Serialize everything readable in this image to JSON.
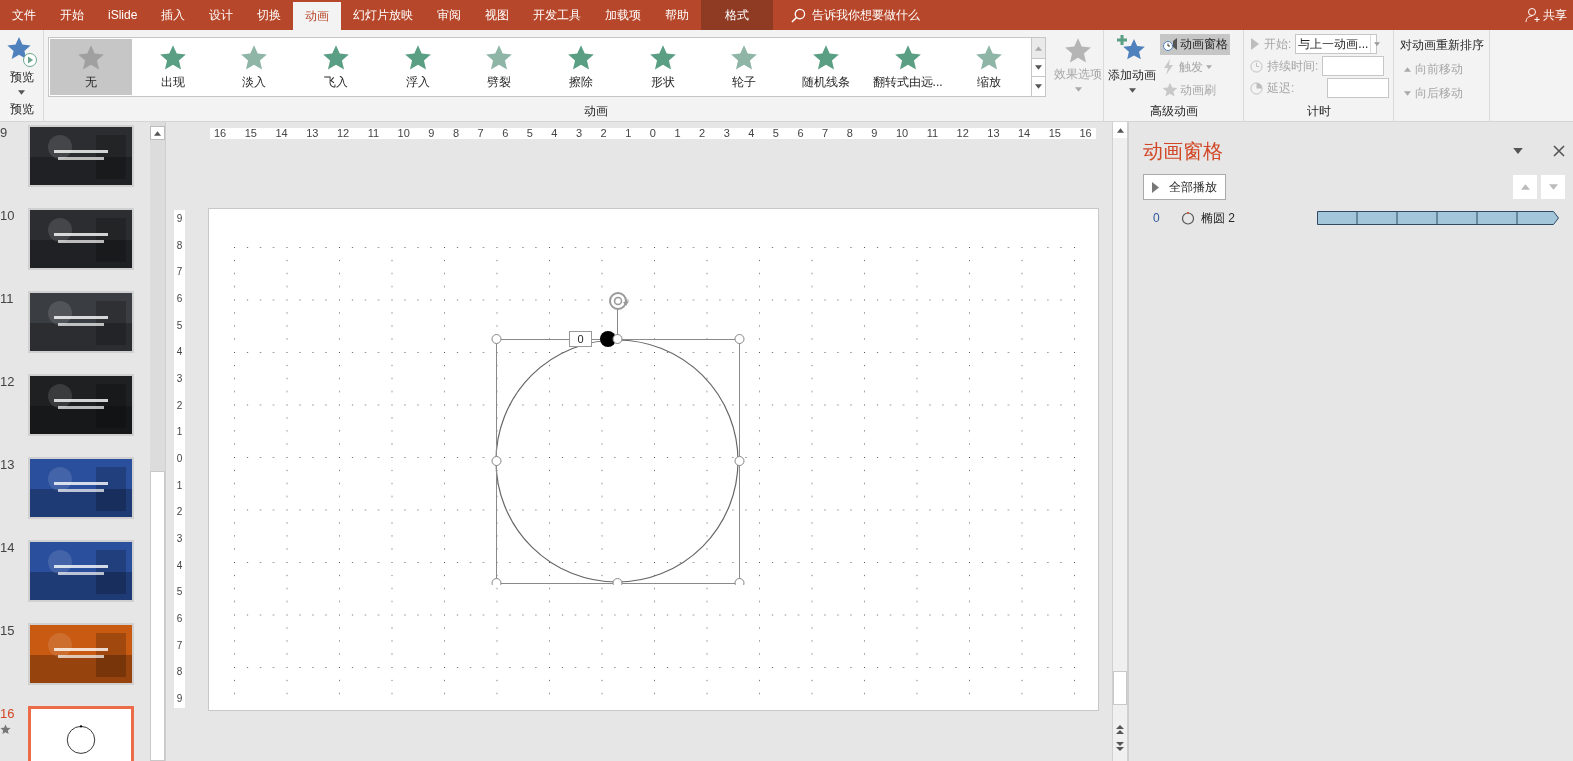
{
  "tabs": [
    {
      "label": "文件",
      "kind": "normal",
      "selected": false
    },
    {
      "label": "开始",
      "kind": "normal",
      "selected": false
    },
    {
      "label": "iSlide",
      "kind": "normal",
      "selected": false
    },
    {
      "label": "插入",
      "kind": "normal",
      "selected": false
    },
    {
      "label": "设计",
      "kind": "normal",
      "selected": false
    },
    {
      "label": "切换",
      "kind": "normal",
      "selected": false
    },
    {
      "label": "动画",
      "kind": "normal",
      "selected": true
    },
    {
      "label": "幻灯片放映",
      "kind": "normal",
      "selected": false
    },
    {
      "label": "审阅",
      "kind": "normal",
      "selected": false
    },
    {
      "label": "视图",
      "kind": "normal",
      "selected": false
    },
    {
      "label": "开发工具",
      "kind": "normal",
      "selected": false
    },
    {
      "label": "加载项",
      "kind": "normal",
      "selected": false
    },
    {
      "label": "帮助",
      "kind": "normal",
      "selected": false
    },
    {
      "label": "格式",
      "kind": "contextual",
      "selected": false
    }
  ],
  "search": {
    "placeholder": "告诉我你想要做什么"
  },
  "share": "共享",
  "preview": {
    "label": "预览",
    "group": "预览"
  },
  "animations": {
    "group": "动画",
    "items": [
      {
        "label": "无",
        "selected": true
      },
      {
        "label": "出现",
        "selected": false
      },
      {
        "label": "淡入",
        "selected": false
      },
      {
        "label": "飞入",
        "selected": false
      },
      {
        "label": "浮入",
        "selected": false
      },
      {
        "label": "劈裂",
        "selected": false
      },
      {
        "label": "擦除",
        "selected": false
      },
      {
        "label": "形状",
        "selected": false
      },
      {
        "label": "轮子",
        "selected": false
      },
      {
        "label": "随机线条",
        "selected": false
      },
      {
        "label": "翻转式由远...",
        "selected": false
      },
      {
        "label": "缩放",
        "selected": false
      }
    ]
  },
  "effect_options": {
    "label": "效果选项",
    "disabled": true
  },
  "advanced": {
    "group": "高级动画",
    "add": "添加动画",
    "pane": {
      "label": "动画窗格",
      "selected": true
    },
    "trigger": {
      "label": "触发",
      "disabled": true
    },
    "painter": {
      "label": "动画刷",
      "disabled": true
    }
  },
  "timing": {
    "group": "计时",
    "start": {
      "label": "开始:",
      "value": "与上一动画...",
      "disabled": true
    },
    "duration": {
      "label": "持续时间:",
      "disabled": true
    },
    "delay": {
      "label": "延迟:",
      "disabled": true
    },
    "reorder": "对动画重新排序",
    "earlier": {
      "label": "向前移动",
      "disabled": true
    },
    "later": {
      "label": "向后移动",
      "disabled": true
    }
  },
  "slides": [
    {
      "number": "9",
      "selected": false,
      "animated": false,
      "color": "#2b2d30"
    },
    {
      "number": "10",
      "selected": false,
      "animated": false,
      "color": "#2b2d30"
    },
    {
      "number": "11",
      "selected": false,
      "animated": false,
      "color": "#3a3d42"
    },
    {
      "number": "12",
      "selected": false,
      "animated": false,
      "color": "#1f2022"
    },
    {
      "number": "13",
      "selected": false,
      "animated": false,
      "color": "#2a4f9c"
    },
    {
      "number": "14",
      "selected": false,
      "animated": false,
      "color": "#2a4f9c"
    },
    {
      "number": "15",
      "selected": false,
      "animated": false,
      "color": "#c85a12"
    },
    {
      "number": "16",
      "selected": true,
      "animated": true,
      "kind": "shape",
      "color": "#ffffff"
    }
  ],
  "ruler": {
    "horizontal": [
      "16",
      "15",
      "14",
      "13",
      "12",
      "11",
      "10",
      "9",
      "8",
      "7",
      "6",
      "5",
      "4",
      "3",
      "2",
      "1",
      "0",
      "1",
      "2",
      "3",
      "4",
      "5",
      "6",
      "7",
      "8",
      "9",
      "10",
      "11",
      "12",
      "13",
      "14",
      "15",
      "16"
    ],
    "vertical": [
      "9",
      "8",
      "7",
      "6",
      "5",
      "4",
      "3",
      "2",
      "1",
      "0",
      "1",
      "2",
      "3",
      "4",
      "5",
      "6",
      "7",
      "8",
      "9"
    ]
  },
  "canvas": {
    "animation_tag": "0"
  },
  "pane": {
    "title": "动画窗格",
    "play_all": "全部播放",
    "items": [
      {
        "number": "0",
        "name": "椭圆 2"
      }
    ]
  }
}
